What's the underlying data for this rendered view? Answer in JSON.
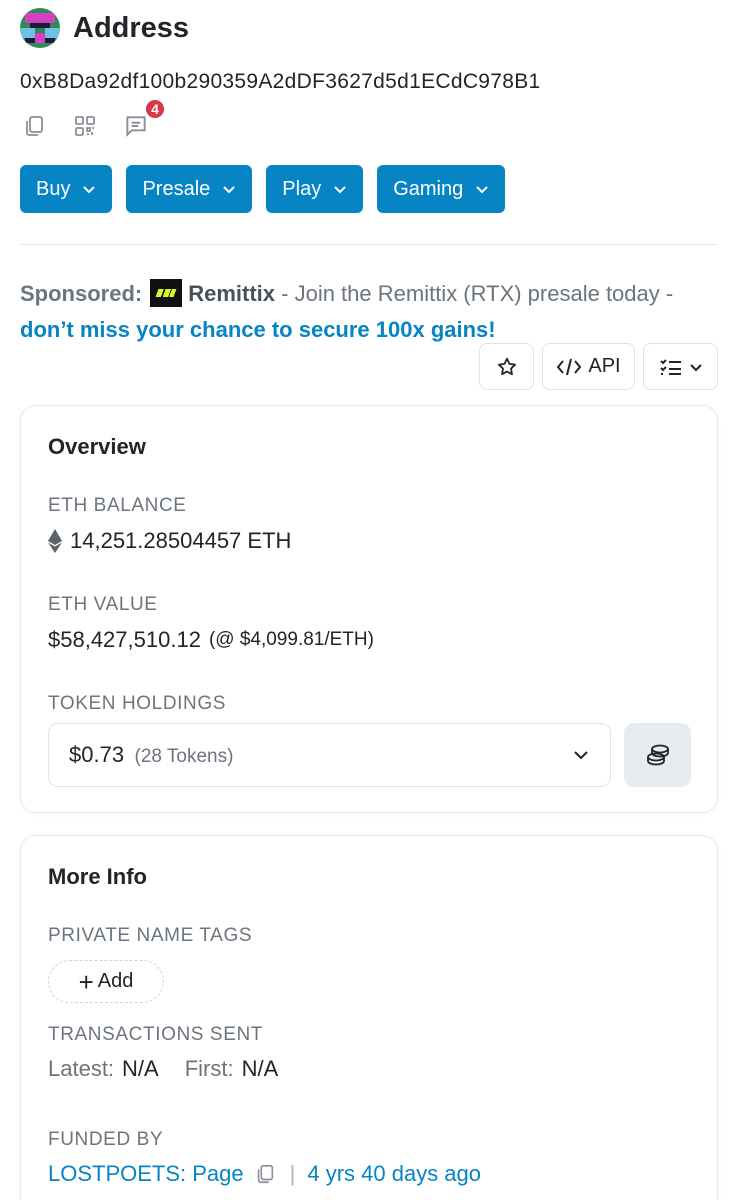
{
  "header": {
    "title": "Address"
  },
  "address": {
    "value": "0xB8Da92df100b290359A2dDF3627d5d1ECdC978B1"
  },
  "address_actions": {
    "notification_count": "4"
  },
  "menus": [
    {
      "label": "Buy"
    },
    {
      "label": "Presale"
    },
    {
      "label": "Play"
    },
    {
      "label": "Gaming"
    }
  ],
  "sponsored": {
    "label": "Sponsored:",
    "brand": "Remittix",
    "text": " - Join the Remittix (RTX) presale today - ",
    "link": "don’t miss your chance to secure 100x gains!"
  },
  "tools": {
    "api_label": "API"
  },
  "overview": {
    "title": "Overview",
    "eth_balance_label": "ETH BALANCE",
    "eth_balance": "14,251.28504457 ETH",
    "eth_value_label": "ETH VALUE",
    "eth_value": "$58,427,510.12",
    "eth_price": "(@ $4,099.81/ETH)",
    "token_holdings_label": "TOKEN HOLDINGS",
    "token_value": "$0.73",
    "token_count": "(28 Tokens)"
  },
  "more_info": {
    "title": "More Info",
    "private_tags_label": "PRIVATE NAME TAGS",
    "add_label": "Add",
    "tx_sent_label": "TRANSACTIONS SENT",
    "latest_key": "Latest:",
    "latest_value": "N/A",
    "first_key": "First:",
    "first_value": "N/A",
    "funded_by_label": "FUNDED BY",
    "funded_by": "LOSTPOETS: Page",
    "funded_age": "4 yrs 40 days ago"
  },
  "colors": {
    "accent": "#0784c3",
    "badge": "#dc3545"
  }
}
